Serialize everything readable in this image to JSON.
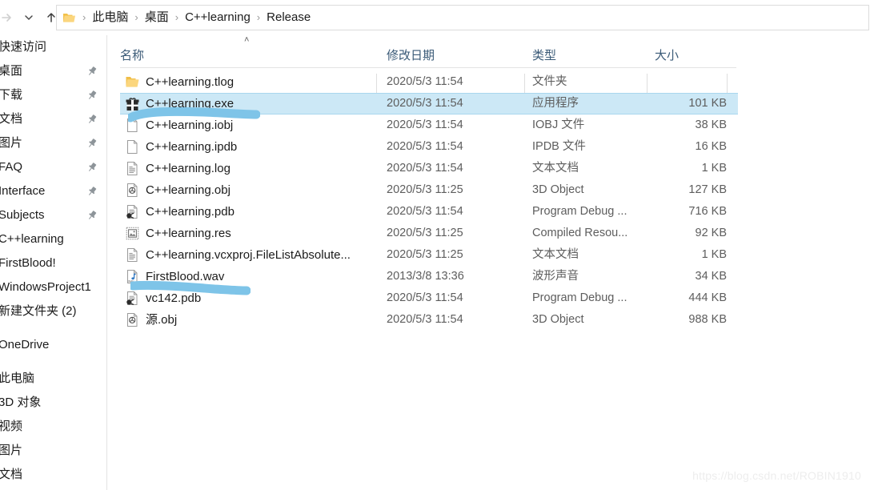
{
  "window": {
    "watermark": "https://blog.csdn.net/ROBIN1910"
  },
  "navbar": {
    "forward_icon": "arrow-right-icon",
    "recent_icon": "chevron-down-icon",
    "up_icon": "arrow-up-icon",
    "breadcrumb": {
      "folder_icon": "folder-icon",
      "separator": "›",
      "items": [
        {
          "label": "此电脑"
        },
        {
          "label": "桌面"
        },
        {
          "label": "C++learning"
        },
        {
          "label": "Release"
        }
      ]
    }
  },
  "sidebar": {
    "items": [
      {
        "label": "快速访问",
        "pinned": false,
        "header": true
      },
      {
        "label": "桌面",
        "pinned": true
      },
      {
        "label": "下载",
        "pinned": true
      },
      {
        "label": "文档",
        "pinned": true
      },
      {
        "label": "图片",
        "pinned": true
      },
      {
        "label": "FAQ",
        "pinned": true
      },
      {
        "label": "Interface",
        "pinned": true
      },
      {
        "label": "Subjects",
        "pinned": true
      },
      {
        "label": "C++learning",
        "pinned": false
      },
      {
        "label": "FirstBlood!",
        "pinned": false
      },
      {
        "label": "WindowsProject1",
        "pinned": false
      },
      {
        "label": "新建文件夹 (2)",
        "pinned": false
      },
      {
        "label": "OneDrive",
        "pinned": false,
        "gap_before": true
      },
      {
        "label": "此电脑",
        "pinned": false,
        "gap_before": true
      },
      {
        "label": "3D 对象",
        "pinned": false
      },
      {
        "label": "视频",
        "pinned": false
      },
      {
        "label": "图片",
        "pinned": false
      },
      {
        "label": "文档",
        "pinned": false
      }
    ]
  },
  "filelist": {
    "columns": [
      {
        "key": "name",
        "label": "名称",
        "sorted": "asc",
        "sort_glyph": "˄"
      },
      {
        "key": "date",
        "label": "修改日期"
      },
      {
        "key": "type",
        "label": "类型"
      },
      {
        "key": "size",
        "label": "大小"
      }
    ],
    "rows": [
      {
        "icon": "folder-icon",
        "name": "C++learning.tlog",
        "date": "2020/5/3 11:54",
        "type": "文件夹",
        "size": "",
        "selected": false
      },
      {
        "icon": "application-exe-icon",
        "name": "C++learning.exe",
        "date": "2020/5/3 11:54",
        "type": "应用程序",
        "size": "101 KB",
        "selected": true
      },
      {
        "icon": "blank-file-icon",
        "name": "C++learning.iobj",
        "date": "2020/5/3 11:54",
        "type": "IOBJ 文件",
        "size": "38 KB",
        "selected": false
      },
      {
        "icon": "blank-file-icon",
        "name": "C++learning.ipdb",
        "date": "2020/5/3 11:54",
        "type": "IPDB 文件",
        "size": "16 KB",
        "selected": false
      },
      {
        "icon": "text-document-icon",
        "name": "C++learning.log",
        "date": "2020/5/3 11:54",
        "type": "文本文档",
        "size": "1 KB",
        "selected": false
      },
      {
        "icon": "3d-object-icon",
        "name": "C++learning.obj",
        "date": "2020/5/3 11:25",
        "type": "3D Object",
        "size": "127 KB",
        "selected": false
      },
      {
        "icon": "program-debug-icon",
        "name": "C++learning.pdb",
        "date": "2020/5/3 11:54",
        "type": "Program Debug ...",
        "size": "716 KB",
        "selected": false
      },
      {
        "icon": "compiled-resource-icon",
        "name": "C++learning.res",
        "date": "2020/5/3 11:25",
        "type": "Compiled Resou...",
        "size": "92 KB",
        "selected": false
      },
      {
        "icon": "text-document-icon",
        "name": "C++learning.vcxproj.FileListAbsolute...",
        "date": "2020/5/3 11:25",
        "type": "文本文档",
        "size": "1 KB",
        "selected": false
      },
      {
        "icon": "wave-audio-icon",
        "name": "FirstBlood.wav",
        "date": "2013/3/8 13:36",
        "type": "波形声音",
        "size": "34 KB",
        "selected": false
      },
      {
        "icon": "program-debug-icon",
        "name": "vc142.pdb",
        "date": "2020/5/3 11:54",
        "type": "Program Debug ...",
        "size": "444 KB",
        "selected": false
      },
      {
        "icon": "3d-object-icon",
        "name": "源.obj",
        "date": "2020/5/3 11:54",
        "type": "3D Object",
        "size": "988 KB",
        "selected": false
      }
    ]
  },
  "annotations": [
    {
      "name": "marker-underline-exe",
      "target": "C++learning.exe",
      "color": "#7ec4e8"
    },
    {
      "name": "marker-underline-wav",
      "target": "FirstBlood.wav",
      "color": "#7ec4e8"
    }
  ],
  "colors": {
    "selection_fill": "#cce8f6",
    "selection_border": "#a9d7ee",
    "header_text": "#3a5a77",
    "folder_yellow": "#fcc75b",
    "marker_blue": "#7ec4e8"
  }
}
